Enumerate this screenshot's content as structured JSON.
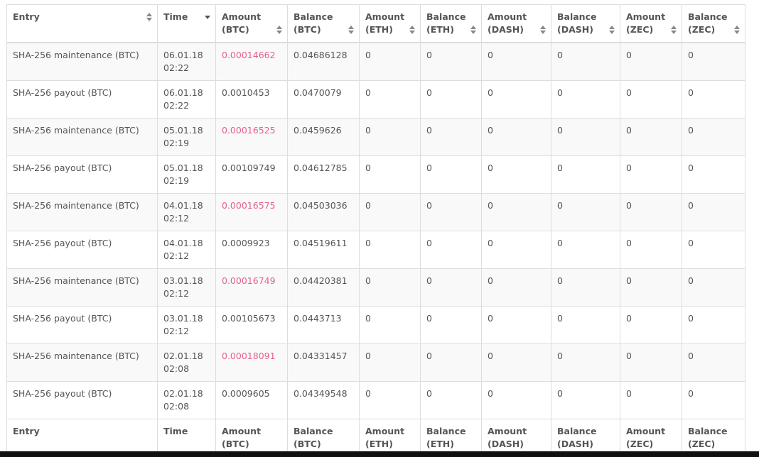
{
  "table": {
    "headers": [
      {
        "label": "Entry",
        "sort": "both"
      },
      {
        "label": "Time",
        "sort": "desc"
      },
      {
        "label": "Amount\n(BTC)",
        "sort": "both"
      },
      {
        "label": "Balance\n(BTC)",
        "sort": "both"
      },
      {
        "label": "Amount\n(ETH)",
        "sort": "both"
      },
      {
        "label": "Balance\n(ETH)",
        "sort": "both"
      },
      {
        "label": "Amount\n(DASH)",
        "sort": "both"
      },
      {
        "label": "Balance\n(DASH)",
        "sort": "both"
      },
      {
        "label": "Amount\n(ZEC)",
        "sort": "both"
      },
      {
        "label": "Balance\n(ZEC)",
        "sort": "both"
      }
    ],
    "footer": [
      "Entry",
      "Time",
      "Amount\n(BTC)",
      "Balance\n(BTC)",
      "Amount\n(ETH)",
      "Balance\n(ETH)",
      "Amount\n(DASH)",
      "Balance\n(DASH)",
      "Amount\n(ZEC)",
      "Balance\n(ZEC)"
    ],
    "rows": [
      {
        "entry": "SHA-256 maintenance (BTC)",
        "time": "06.01.18\n02:22",
        "amount_btc": "0.00014662",
        "negative": true,
        "balance_btc": "0.04686128",
        "amount_eth": "0",
        "balance_eth": "0",
        "amount_dash": "0",
        "balance_dash": "0",
        "amount_zec": "0",
        "balance_zec": "0"
      },
      {
        "entry": "SHA-256 payout (BTC)",
        "time": "06.01.18\n02:22",
        "amount_btc": "0.0010453",
        "negative": false,
        "balance_btc": "0.0470079",
        "amount_eth": "0",
        "balance_eth": "0",
        "amount_dash": "0",
        "balance_dash": "0",
        "amount_zec": "0",
        "balance_zec": "0"
      },
      {
        "entry": "SHA-256 maintenance (BTC)",
        "time": "05.01.18\n02:19",
        "amount_btc": "0.00016525",
        "negative": true,
        "balance_btc": "0.0459626",
        "amount_eth": "0",
        "balance_eth": "0",
        "amount_dash": "0",
        "balance_dash": "0",
        "amount_zec": "0",
        "balance_zec": "0"
      },
      {
        "entry": "SHA-256 payout (BTC)",
        "time": "05.01.18\n02:19",
        "amount_btc": "0.00109749",
        "negative": false,
        "balance_btc": "0.04612785",
        "amount_eth": "0",
        "balance_eth": "0",
        "amount_dash": "0",
        "balance_dash": "0",
        "amount_zec": "0",
        "balance_zec": "0"
      },
      {
        "entry": "SHA-256 maintenance (BTC)",
        "time": "04.01.18\n02:12",
        "amount_btc": "0.00016575",
        "negative": true,
        "balance_btc": "0.04503036",
        "amount_eth": "0",
        "balance_eth": "0",
        "amount_dash": "0",
        "balance_dash": "0",
        "amount_zec": "0",
        "balance_zec": "0"
      },
      {
        "entry": "SHA-256 payout (BTC)",
        "time": "04.01.18\n02:12",
        "amount_btc": "0.0009923",
        "negative": false,
        "balance_btc": "0.04519611",
        "amount_eth": "0",
        "balance_eth": "0",
        "amount_dash": "0",
        "balance_dash": "0",
        "amount_zec": "0",
        "balance_zec": "0"
      },
      {
        "entry": "SHA-256 maintenance (BTC)",
        "time": "03.01.18\n02:12",
        "amount_btc": "0.00016749",
        "negative": true,
        "balance_btc": "0.04420381",
        "amount_eth": "0",
        "balance_eth": "0",
        "amount_dash": "0",
        "balance_dash": "0",
        "amount_zec": "0",
        "balance_zec": "0"
      },
      {
        "entry": "SHA-256 payout (BTC)",
        "time": "03.01.18\n02:12",
        "amount_btc": "0.00105673",
        "negative": false,
        "balance_btc": "0.0443713",
        "amount_eth": "0",
        "balance_eth": "0",
        "amount_dash": "0",
        "balance_dash": "0",
        "amount_zec": "0",
        "balance_zec": "0"
      },
      {
        "entry": "SHA-256 maintenance (BTC)",
        "time": "02.01.18\n02:08",
        "amount_btc": "0.00018091",
        "negative": true,
        "balance_btc": "0.04331457",
        "amount_eth": "0",
        "balance_eth": "0",
        "amount_dash": "0",
        "balance_dash": "0",
        "amount_zec": "0",
        "balance_zec": "0"
      },
      {
        "entry": "SHA-256 payout (BTC)",
        "time": "02.01.18\n02:08",
        "amount_btc": "0.0009605",
        "negative": false,
        "balance_btc": "0.04349548",
        "amount_eth": "0",
        "balance_eth": "0",
        "amount_dash": "0",
        "balance_dash": "0",
        "amount_zec": "0",
        "balance_zec": "0"
      }
    ]
  },
  "colors": {
    "negative_amount": "#e8608a",
    "border": "#dddddd",
    "stripe": "#f9f9f9",
    "text": "#555555"
  },
  "icons": {
    "sort_both": "sort-both-icon",
    "sort_desc": "sort-desc-icon"
  }
}
